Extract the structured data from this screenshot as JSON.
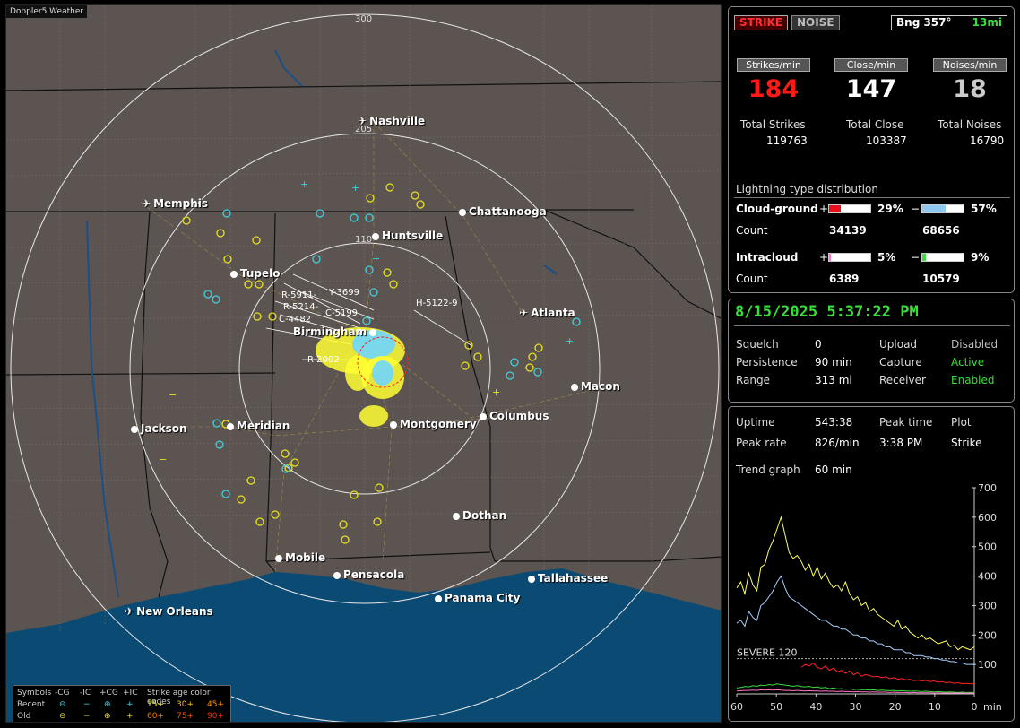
{
  "app": {
    "title": "Doppler5 Weather"
  },
  "map": {
    "ring_labels": [
      "300",
      "205",
      "110"
    ],
    "cities": [
      {
        "name": "Nashville",
        "icon": "airport"
      },
      {
        "name": "Memphis",
        "icon": "airport"
      },
      {
        "name": "Chattanooga",
        "icon": "dot"
      },
      {
        "name": "Huntsville",
        "icon": "dot"
      },
      {
        "name": "Tupelo",
        "icon": "dot"
      },
      {
        "name": "Atlanta",
        "icon": "airport"
      },
      {
        "name": "Birmingham",
        "icon": "dot"
      },
      {
        "name": "Macon",
        "icon": "dot"
      },
      {
        "name": "Jackson",
        "icon": "dot"
      },
      {
        "name": "Meridian",
        "icon": "dot"
      },
      {
        "name": "Montgomery",
        "icon": "dot"
      },
      {
        "name": "Columbus",
        "icon": "dot"
      },
      {
        "name": "Dothan",
        "icon": "dot"
      },
      {
        "name": "Mobile",
        "icon": "dot"
      },
      {
        "name": "Pensacola",
        "icon": "dot"
      },
      {
        "name": "Tallahassee",
        "icon": "dot"
      },
      {
        "name": "Panama City",
        "icon": "dot"
      },
      {
        "name": "New Orleans",
        "icon": "airport"
      }
    ],
    "cell_labels": [
      "H-5122-9",
      "R-5911-",
      "R-5214-",
      "C-4482",
      "R-2002",
      "Y-3699",
      "C-5199"
    ],
    "legend": {
      "header": [
        "Symbols",
        "-CG",
        "-IC",
        "+CG",
        "+IC",
        "Strike age color codes"
      ],
      "recent": {
        "label": "Recent",
        "codes": [
          "15+",
          "30+",
          "45+"
        ]
      },
      "old": {
        "label": "Old",
        "codes": [
          "60+",
          "75+",
          "90+"
        ]
      }
    }
  },
  "strike_panel": {
    "mode_strike": "STRIKE",
    "mode_noise": "NOISE",
    "bearing": "Bng 357°",
    "distance": "13mi",
    "strikes_min_label": "Strikes/min",
    "close_min_label": "Close/min",
    "noises_min_label": "Noises/min",
    "strikes_min": "184",
    "close_min": "147",
    "noises_min": "18",
    "total_strikes_label": "Total Strikes",
    "total_close_label": "Total Close",
    "total_noises_label": "Total Noises",
    "total_strikes": "119763",
    "total_close": "103387",
    "total_noises": "16790",
    "dist_title": "Lightning type distribution",
    "cg_label": "Cloud-ground",
    "ic_label": "Intracloud",
    "count_label": "Count",
    "plus": "+",
    "minus": "−",
    "cg_pos_pct": "29%",
    "cg_neg_pct": "57%",
    "ic_pos_pct": "5%",
    "ic_neg_pct": "9%",
    "cg_pos_count": "34139",
    "cg_neg_count": "68656",
    "ic_pos_count": "6389",
    "ic_neg_count": "10579",
    "cg_pos_fill": 0.29,
    "cg_neg_fill": 0.57,
    "ic_pos_fill": 0.05,
    "ic_neg_fill": 0.09
  },
  "status_panel": {
    "datetime": "8/15/2025 5:37:22 PM",
    "squelch_label": "Squelch",
    "squelch": "0",
    "persistence_label": "Persistence",
    "persistence": "90 min",
    "range_label": "Range",
    "range": "313 mi",
    "upload_label": "Upload",
    "upload": "Disabled",
    "capture_label": "Capture",
    "capture": "Active",
    "receiver_label": "Receiver",
    "receiver": "Enabled"
  },
  "trend_panel": {
    "uptime_label": "Uptime",
    "uptime": "543:38",
    "peak_time_label": "Peak time",
    "peak_time": "3:38 PM",
    "plot_label": "Plot",
    "plot": "Strike",
    "peak_rate_label": "Peak rate",
    "peak_rate": "826/min",
    "trend_label": "Trend graph",
    "trend": "60 min",
    "severe_label": "SEVERE 120"
  },
  "chart_data": {
    "type": "line",
    "xlabel": "min",
    "x_ticks": [
      60,
      50,
      40,
      30,
      20,
      10,
      0
    ],
    "y_ticks": [
      100,
      200,
      300,
      400,
      500,
      600,
      700
    ],
    "ylim": [
      0,
      700
    ],
    "xlim": [
      60,
      0
    ],
    "threshold": {
      "label": "SEVERE 120",
      "value": 120
    },
    "series": [
      {
        "color": "#ffff66",
        "values": [
          360,
          380,
          340,
          410,
          370,
          350,
          430,
          440,
          490,
          520,
          560,
          600,
          540,
          480,
          460,
          470,
          450,
          420,
          440,
          400,
          430,
          390,
          410,
          380,
          360,
          370,
          350,
          380,
          340,
          320,
          330,
          300,
          310,
          280,
          290,
          270,
          260,
          250,
          240,
          230,
          250,
          220,
          230,
          210,
          200,
          190,
          200,
          185,
          190,
          180,
          170,
          175,
          180,
          160,
          165,
          150,
          160,
          155,
          150,
          160
        ]
      },
      {
        "color": "#a8d0ff",
        "values": [
          240,
          250,
          230,
          280,
          260,
          250,
          300,
          310,
          330,
          350,
          380,
          400,
          360,
          330,
          320,
          310,
          300,
          290,
          280,
          270,
          260,
          250,
          250,
          240,
          230,
          230,
          220,
          220,
          210,
          200,
          200,
          190,
          190,
          180,
          180,
          170,
          170,
          160,
          160,
          150,
          150,
          150,
          140,
          140,
          130,
          130,
          130,
          125,
          125,
          120,
          120,
          115,
          115,
          110,
          110,
          105,
          105,
          100,
          100,
          100
        ]
      },
      {
        "color": "#ff2222",
        "values": [
          null,
          null,
          null,
          null,
          null,
          null,
          null,
          null,
          null,
          null,
          null,
          null,
          null,
          null,
          null,
          null,
          90,
          100,
          95,
          105,
          90,
          85,
          95,
          80,
          88,
          75,
          80,
          70,
          78,
          65,
          72,
          60,
          66,
          62,
          58,
          60,
          55,
          58,
          52,
          55,
          50,
          52,
          48,
          50,
          45,
          47,
          44,
          46,
          42,
          44,
          40,
          42,
          38,
          40,
          36,
          38,
          35,
          36,
          34,
          35
        ]
      },
      {
        "color": "#3ddc3d",
        "values": [
          20,
          22,
          25,
          24,
          28,
          26,
          30,
          28,
          32,
          30,
          34,
          32,
          30,
          28,
          26,
          28,
          25,
          24,
          26,
          22,
          24,
          20,
          22,
          18,
          20,
          17,
          18,
          16,
          17,
          15,
          16,
          14,
          15,
          13,
          14,
          12,
          13,
          12,
          11,
          12,
          10,
          11,
          10,
          9,
          10,
          9,
          8,
          9,
          8,
          7,
          8,
          7,
          6,
          7,
          6,
          5,
          6,
          5,
          5,
          5
        ]
      },
      {
        "color": "#ff77cc",
        "values": [
          10,
          11,
          12,
          12,
          13,
          12,
          14,
          13,
          14,
          13,
          14,
          13,
          12,
          12,
          11,
          12,
          11,
          10,
          11,
          10,
          10,
          9,
          10,
          9,
          9,
          8,
          9,
          8,
          8,
          7,
          8,
          7,
          7,
          6,
          7,
          6,
          6,
          6,
          5,
          6,
          5,
          5,
          5,
          4,
          5,
          4,
          4,
          4,
          4,
          3,
          4,
          3,
          3,
          3,
          3,
          3,
          3,
          2,
          3,
          2
        ]
      }
    ]
  }
}
